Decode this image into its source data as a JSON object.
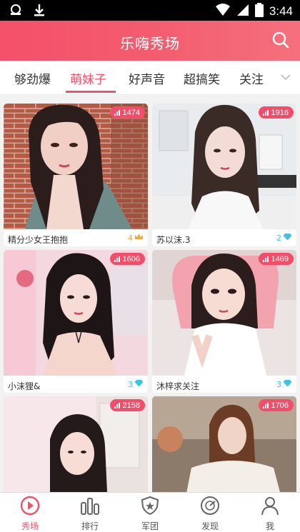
{
  "status_bar": {
    "time": "3:44"
  },
  "header": {
    "title": "乐嗨秀场"
  },
  "tabs": [
    {
      "label": "够劲爆"
    },
    {
      "label": "萌妹子"
    },
    {
      "label": "好声音"
    },
    {
      "label": "超搞笑"
    },
    {
      "label": "关注"
    }
  ],
  "active_tab": "萌妹子",
  "cards": [
    {
      "viewers": "1474",
      "caption": "精分少女王抱抱",
      "level": "4",
      "level_icon": "crown-icon"
    },
    {
      "viewers": "1916",
      "caption": "苏以沫.3",
      "level": "2",
      "level_icon": "diamond-icon"
    },
    {
      "viewers": "1606",
      "caption": "小沫狸&",
      "level": "3",
      "level_icon": "diamond-icon"
    },
    {
      "viewers": "1469",
      "caption": "沐梓求关注",
      "level": "3",
      "level_icon": "diamond-icon"
    },
    {
      "viewers": "2158",
      "caption": "",
      "level": "",
      "level_icon": ""
    },
    {
      "viewers": "1706",
      "caption": "",
      "level": "",
      "level_icon": ""
    }
  ],
  "bottom_nav": [
    {
      "label": "秀场",
      "icon": "play-icon"
    },
    {
      "label": "排行",
      "icon": "ranking-icon"
    },
    {
      "label": "军团",
      "icon": "legion-shield-icon"
    },
    {
      "label": "发现",
      "icon": "discover-icon"
    },
    {
      "label": "我",
      "icon": "profile-icon"
    }
  ],
  "colors": {
    "accent": "#f4506a",
    "badge": "#f44d6a",
    "diamond": "#3bc3e8",
    "crown": "#f2a93b"
  }
}
